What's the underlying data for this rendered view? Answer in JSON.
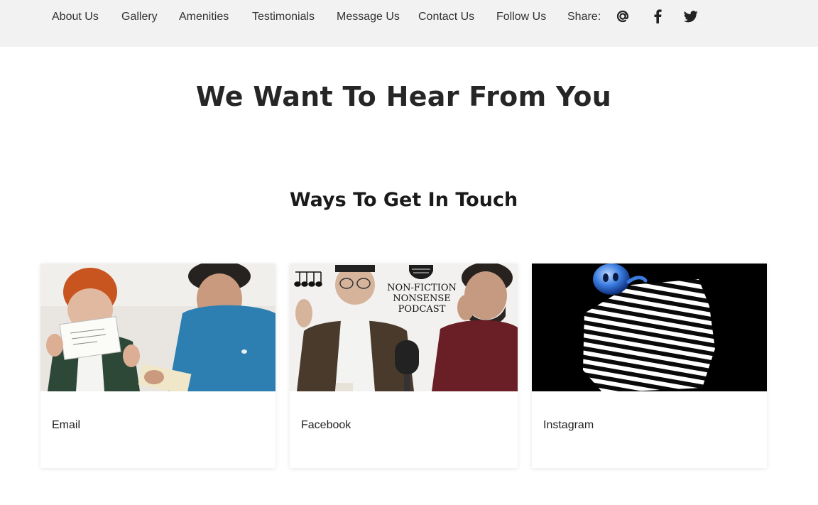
{
  "nav": {
    "items": [
      {
        "label": "About Us"
      },
      {
        "label": "Gallery"
      },
      {
        "label": "Amenities"
      },
      {
        "label": "Testimonials"
      },
      {
        "label": "Message Us"
      },
      {
        "label": "Contact Us"
      },
      {
        "label": "Follow Us"
      }
    ],
    "share_label": "Share:",
    "share_icons": [
      "at-sign-icon",
      "facebook-icon",
      "twitter-icon"
    ]
  },
  "page": {
    "title": "We Want To Hear From You",
    "section_title": "Ways To Get In Touch"
  },
  "cards": [
    {
      "label": "Email",
      "image": "two-men-reading-letter-photo"
    },
    {
      "label": "Facebook",
      "image": "podcast-hosts-photo",
      "image_text": [
        "NON-FICTION",
        "NONSENSE",
        "PODCAST"
      ]
    },
    {
      "label": "Instagram",
      "image": "striped-shape-with-blue-ghost-illustration"
    }
  ],
  "colors": {
    "nav_background": "#f2f2f2",
    "title_text": "#262626",
    "body_background": "#ffffff"
  }
}
